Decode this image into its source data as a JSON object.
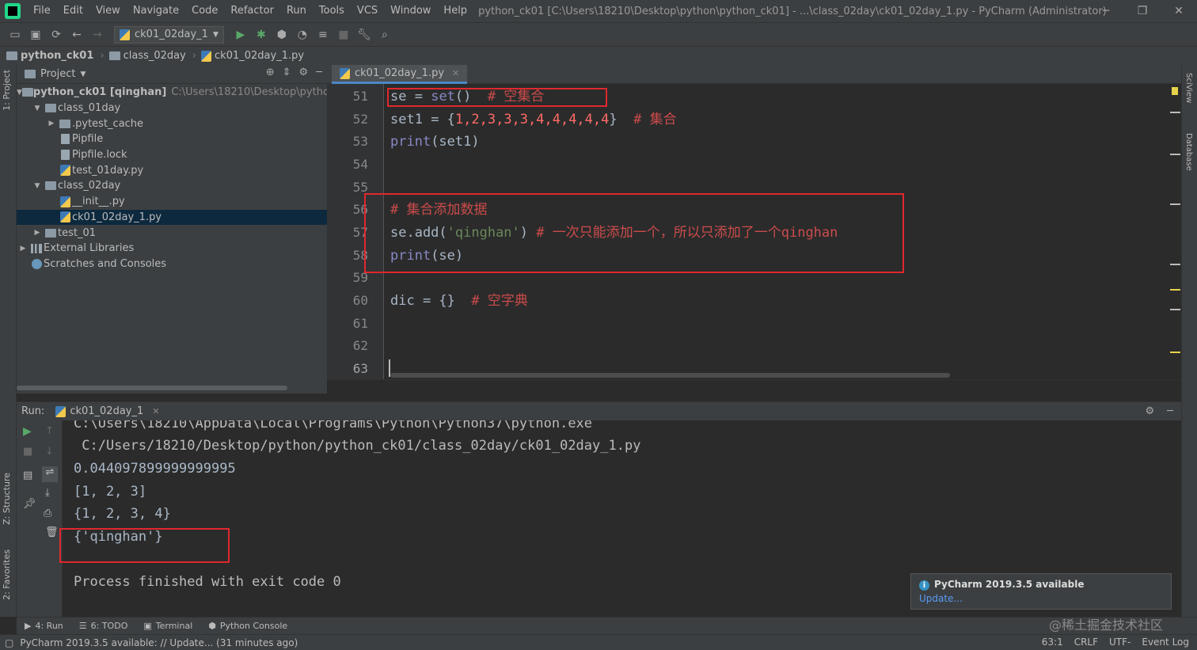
{
  "window": {
    "title": "python_ck01 [C:\\Users\\18210\\Desktop\\python\\python_ck01] - ...\\class_02day\\ck01_02day_1.py - PyCharm (Administrator)",
    "menu": [
      "File",
      "Edit",
      "View",
      "Navigate",
      "Code",
      "Refactor",
      "Run",
      "Tools",
      "VCS",
      "Window",
      "Help"
    ]
  },
  "toolbar": {
    "run_config": "ck01_02day_1"
  },
  "breadcrumb": [
    "python_ck01",
    "class_02day",
    "ck01_02day_1.py"
  ],
  "left_strip": {
    "project": "1: Project",
    "structure": "Z: Structure",
    "favorites": "2: Favorites"
  },
  "right_strip": {
    "sciview": "SciView",
    "database": "Database"
  },
  "project": {
    "title": "Project",
    "root": {
      "name": "python_ck01 [qinghan]",
      "path": "C:\\Users\\18210\\Desktop\\python\\pytl"
    },
    "items": [
      {
        "label": "class_01day"
      },
      {
        "label": ".pytest_cache"
      },
      {
        "label": "Pipfile"
      },
      {
        "label": "Pipfile.lock"
      },
      {
        "label": "test_01day.py"
      },
      {
        "label": "class_02day"
      },
      {
        "label": "__init__.py"
      },
      {
        "label": "ck01_02day_1.py"
      },
      {
        "label": "test_01"
      },
      {
        "label": "External Libraries"
      },
      {
        "label": "Scratches and Consoles"
      }
    ]
  },
  "editor": {
    "tab": "ck01_02day_1.py",
    "line_numbers": [
      "51",
      "52",
      "53",
      "54",
      "55",
      "56",
      "57",
      "58",
      "59",
      "60",
      "61",
      "62",
      "63"
    ],
    "code": {
      "l51_a": "se",
      "l51_b": " = ",
      "l51_c": "set",
      "l51_d": "()  ",
      "l51_e": "# 空集合",
      "l52_a": "set1",
      "l52_b": " = {",
      "l52_c": "1,2,3,3,3,4,4,4,4,4",
      "l52_d": "}  ",
      "l52_e": "# 集合",
      "l53_a": "print",
      "l53_b": "(set1)",
      "l56_a": "# 集合添加数据",
      "l57_a": "se.add(",
      "l57_b": "'qinghan'",
      "l57_c": ") ",
      "l57_d": "# 一次只能添加一个，所以只添加了一个qinghan",
      "l58_a": "print",
      "l58_b": "(se)",
      "l60_a": "dic",
      "l60_b": " = {}  ",
      "l60_c": "# 空字典"
    }
  },
  "run": {
    "label": "Run:",
    "tab": "ck01_02day_1",
    "output": [
      "C:\\Users\\18210\\AppData\\Local\\Programs\\Python\\Python37\\python.exe",
      " C:/Users/18210/Desktop/python/python_ck01/class_02day/ck01_02day_1.py",
      "0.044097899999999995",
      "[1, 2, 3]",
      "{1, 2, 3, 4}",
      "{'qinghan'}",
      "",
      "Process finished with exit code 0"
    ]
  },
  "notification": {
    "title": "PyCharm 2019.3.5 available",
    "link": "Update..."
  },
  "tool_tabs": [
    "4: Run",
    "6: TODO",
    "Terminal",
    "Python Console"
  ],
  "status": {
    "message": "PyCharm 2019.3.5 available: // Update... (31 minutes ago)",
    "position": "63:1",
    "line_sep": "CRLF",
    "encoding": "UTF-",
    "event_log": "Event Log"
  },
  "watermark": "@稀土掘金技术社区",
  "colors": {
    "accent": "#4a88c7",
    "highlight_box": "#e0282e",
    "selection": "#0d293e"
  }
}
